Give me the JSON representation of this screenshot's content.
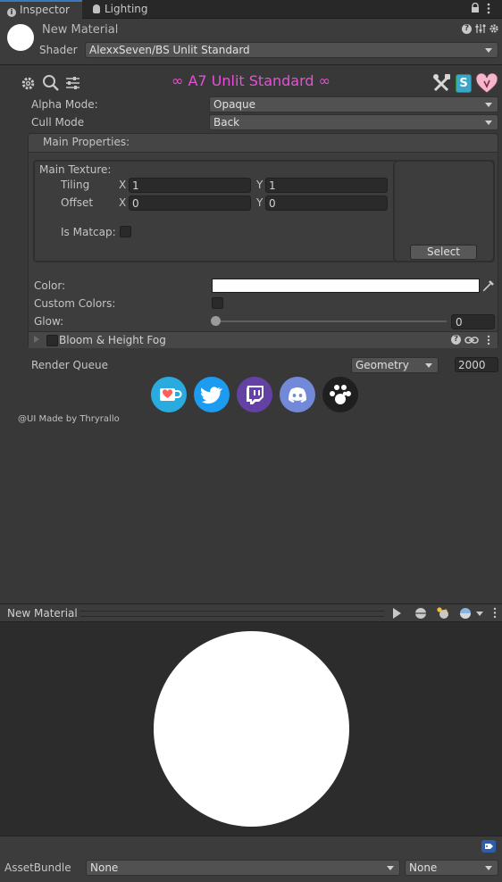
{
  "tabs": {
    "inspector": "Inspector",
    "lighting": "Lighting"
  },
  "material": {
    "name": "New Material",
    "shader_label": "Shader",
    "shader_value": "AlexxSeven/BS Unlit Standard"
  },
  "shader_title": "∞ A7 Unlit Standard ∞",
  "alpha_mode": {
    "label": "Alpha Mode:",
    "value": "Opaque"
  },
  "cull_mode": {
    "label": "Cull Mode",
    "value": "Back"
  },
  "main_properties": {
    "header": "Main Properties:",
    "texture_label": "Main Texture:",
    "tiling_label": "Tiling",
    "offset_label": "Offset",
    "axis_x": "X",
    "axis_y": "Y",
    "tiling_x": "1",
    "tiling_y": "1",
    "offset_x": "0",
    "offset_y": "0",
    "is_matcap_label": "Is Matcap:",
    "is_matcap": false,
    "select_label": "Select",
    "color_label": "Color:",
    "color_value": "#ffffff",
    "custom_colors_label": "Custom Colors:",
    "custom_colors": false,
    "glow_label": "Glow:",
    "glow_value": "0"
  },
  "bloom": {
    "label": "Bloom & Height Fog",
    "enabled": false
  },
  "render_queue": {
    "label": "Render Queue",
    "mode": "Geometry",
    "value": "2000"
  },
  "social_icons": [
    "kofi-icon",
    "twitter-icon",
    "twitch-icon",
    "discord-icon",
    "paw-icon"
  ],
  "credit": "@UI Made by Thryrallo",
  "preview": {
    "title": "New Material"
  },
  "asset_bundle": {
    "label": "AssetBundle",
    "name": "None",
    "variant": "None"
  },
  "colors": {
    "title_pink": "#e84fd9",
    "background": "#383838",
    "preview_bg": "#2c2c2c",
    "accent": "#3a79bb"
  }
}
